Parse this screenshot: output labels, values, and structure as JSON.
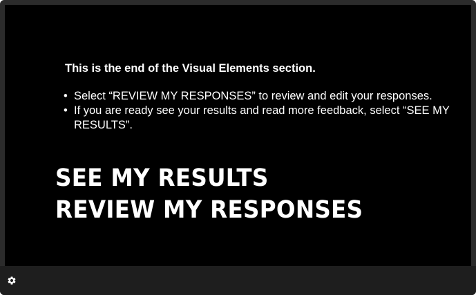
{
  "slide": {
    "heading": "This is the end of the Visual Elements section.",
    "bullets": [
      {
        "text": "Select “REVIEW MY RESPONSES” to review and edit your responses."
      },
      {
        "text": "If you are ready see your results and read more feedback, select “SEE MY RESULTS”."
      }
    ],
    "bullet_symbol": "•",
    "see_results_label": "SEE MY RESULTS",
    "review_responses_label": "REVIEW MY RESPONSES"
  },
  "toolbar": {
    "settings_icon": "gear-icon"
  },
  "colors": {
    "slide_background": "#000000",
    "frame": "#2b2b2b",
    "toolbar": "#1e1e1e",
    "text": "#ffffff"
  }
}
